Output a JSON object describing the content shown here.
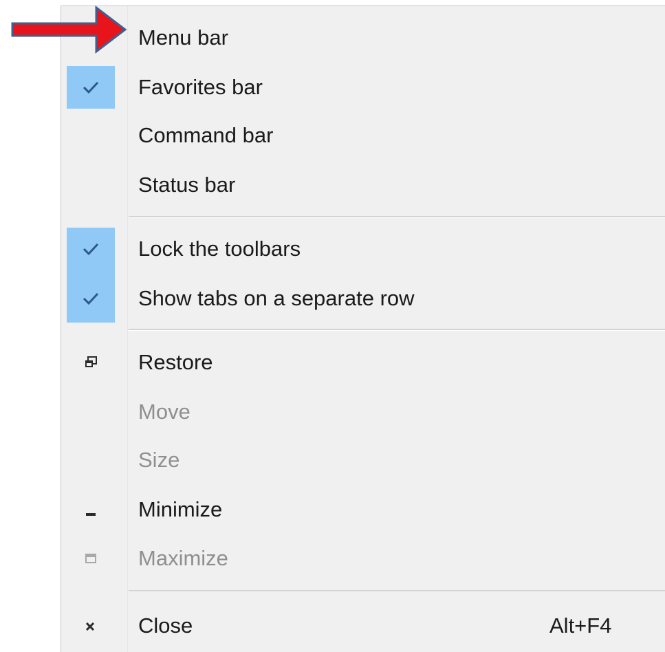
{
  "menu": {
    "items": [
      {
        "label": "Menu bar",
        "checked": false,
        "enabled": true
      },
      {
        "label": "Favorites bar",
        "checked": true,
        "enabled": true
      },
      {
        "label": "Command bar",
        "checked": false,
        "enabled": true
      },
      {
        "label": "Status bar",
        "checked": false,
        "enabled": true
      },
      {
        "label": "Lock the toolbars",
        "checked": true,
        "enabled": true
      },
      {
        "label": "Show tabs on a separate row",
        "checked": true,
        "enabled": true
      },
      {
        "label": "Restore",
        "icon": "restore-icon",
        "enabled": true
      },
      {
        "label": "Move",
        "enabled": false
      },
      {
        "label": "Size",
        "enabled": false
      },
      {
        "label": "Minimize",
        "icon": "minimize-icon",
        "enabled": true
      },
      {
        "label": "Maximize",
        "icon": "maximize-icon",
        "enabled": false
      },
      {
        "label": "Close",
        "icon": "close-icon",
        "shortcut": "Alt+F4",
        "enabled": true
      }
    ]
  },
  "annotation": {
    "icon": "red-arrow-icon",
    "color": "#e8141c",
    "border_color": "#3f5f8f"
  },
  "colors": {
    "menu_bg": "#f0f0f0",
    "check_highlight": "#90c8f6",
    "disabled_text": "#8f8f8f"
  }
}
